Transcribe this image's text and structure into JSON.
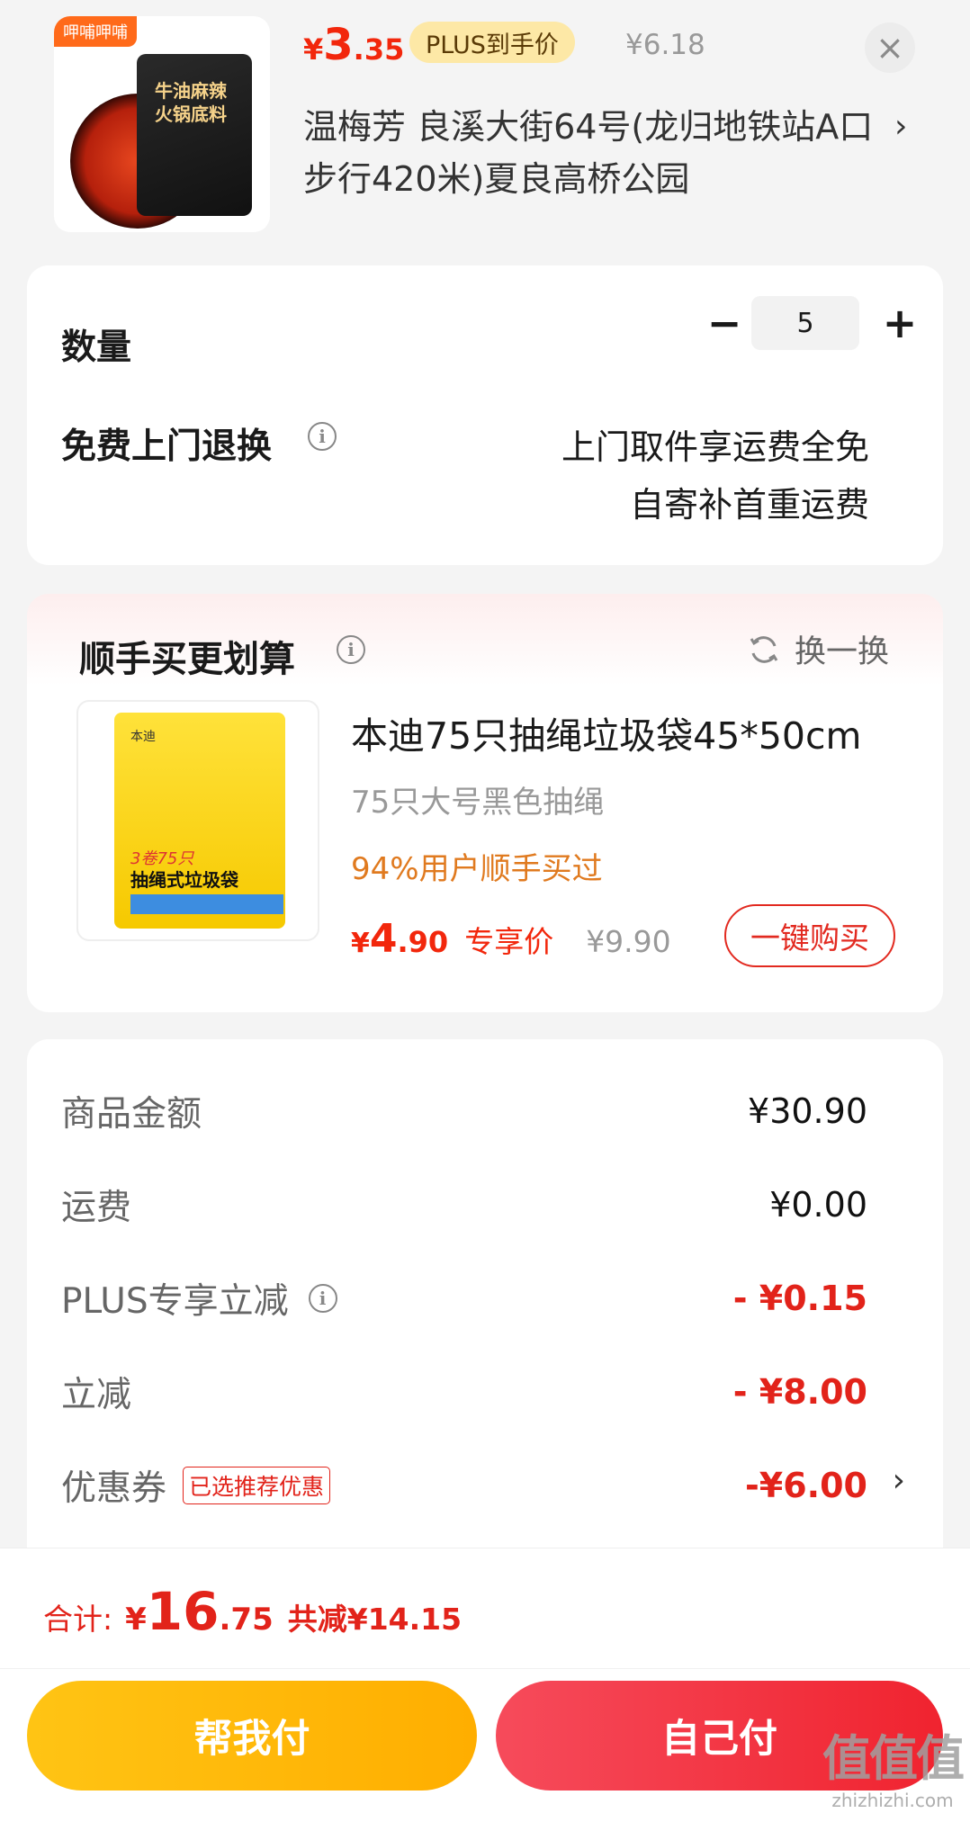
{
  "product": {
    "brand_tag": "呷哺呷哺",
    "pack_text": "牛油麻辣火锅底料",
    "price_currency": "¥",
    "price_int": "3",
    "price_dec": ".35",
    "plus_label": "PLUS到手价",
    "original_price": "¥6.18",
    "close_symbol": "×"
  },
  "address": {
    "text": "温梅芳  良溪大街64号(龙归地铁站A口步行420米)夏良高桥公园",
    "chevron": "›"
  },
  "quantity": {
    "label": "数量",
    "minus": "−",
    "value": "5",
    "plus": "+"
  },
  "return_service": {
    "label": "免费上门退换",
    "info": "i",
    "line1": "上门取件享运费全免",
    "line2": "自寄补首重运费"
  },
  "recommend": {
    "title": "顺手买更划算",
    "info": "i",
    "refresh_label": "换一换",
    "item": {
      "image_logo": "本迪",
      "image_count": "3卷75只",
      "image_name": "抽绳式垃圾袋",
      "name": "本迪75只抽绳垃圾袋45*50cm",
      "spec": "75只大号黑色抽绳",
      "stat": "94%用户顺手买过",
      "price_currency": "¥",
      "price_int": "4",
      "price_dec": ".90",
      "exclusive_label": "专享价",
      "original_price": "¥9.90",
      "buy_label": "一键购买"
    }
  },
  "summary": {
    "rows": [
      {
        "label": "商品金额",
        "value": "¥30.90"
      },
      {
        "label": "运费",
        "value": "¥0.00"
      },
      {
        "label": "PLUS专享立减",
        "value": "- ¥0.15"
      },
      {
        "label": "立减",
        "value": "- ¥8.00"
      },
      {
        "label": "优惠券",
        "tag": "已选推荐优惠",
        "value": "-¥6.00",
        "chevron": "›"
      }
    ]
  },
  "footer": {
    "total_label": "合计:",
    "total_currency": "¥",
    "total_int": "16",
    "total_dec": ".75",
    "saved": "共减¥14.15",
    "help_pay": "帮我付",
    "self_pay": "自己付"
  },
  "watermark": {
    "main": "值值值",
    "sub": "zhizhizhi.com"
  },
  "colors": {
    "accent_red": "#e2231a",
    "plus_pill_bg": "#fde8a6",
    "help_button": "#ffb800",
    "self_button": "#f0232f"
  }
}
